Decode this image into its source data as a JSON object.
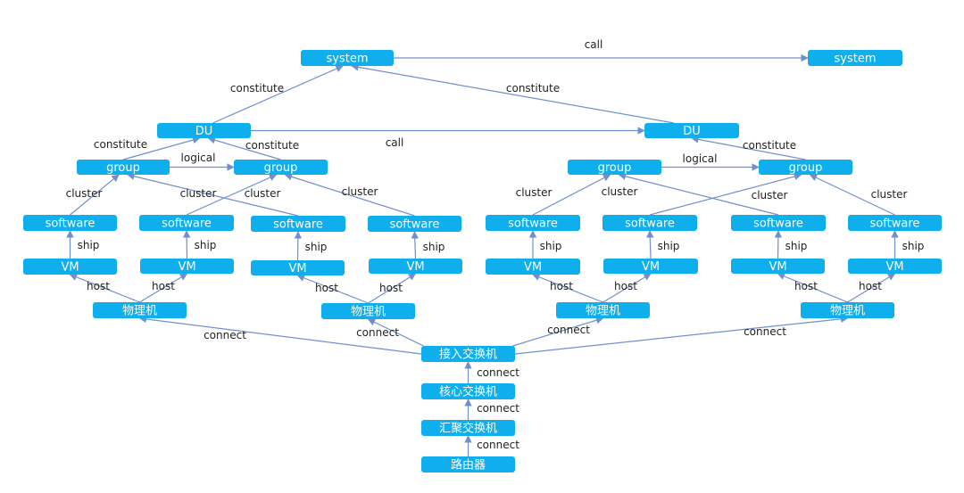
{
  "diagram": {
    "colors": {
      "node_fill": "#0faeec",
      "node_text": "#ffffff",
      "edge": "#6f8fcf",
      "label_text": "#222222"
    },
    "nodes": [
      {
        "id": "system1",
        "label": "system"
      },
      {
        "id": "system2",
        "label": "system"
      },
      {
        "id": "du1",
        "label": "DU"
      },
      {
        "id": "du2",
        "label": "DU"
      },
      {
        "id": "group1",
        "label": "group"
      },
      {
        "id": "group2",
        "label": "group"
      },
      {
        "id": "group3",
        "label": "group"
      },
      {
        "id": "group4",
        "label": "group"
      },
      {
        "id": "sw1",
        "label": "software"
      },
      {
        "id": "sw2",
        "label": "software"
      },
      {
        "id": "sw3",
        "label": "software"
      },
      {
        "id": "sw4",
        "label": "software"
      },
      {
        "id": "sw5",
        "label": "software"
      },
      {
        "id": "sw6",
        "label": "software"
      },
      {
        "id": "sw7",
        "label": "software"
      },
      {
        "id": "sw8",
        "label": "software"
      },
      {
        "id": "vm1",
        "label": "VM"
      },
      {
        "id": "vm2",
        "label": "VM"
      },
      {
        "id": "vm3",
        "label": "VM"
      },
      {
        "id": "vm4",
        "label": "VM"
      },
      {
        "id": "vm5",
        "label": "VM"
      },
      {
        "id": "vm6",
        "label": "VM"
      },
      {
        "id": "vm7",
        "label": "VM"
      },
      {
        "id": "vm8",
        "label": "VM"
      },
      {
        "id": "pm1",
        "label": "物理机"
      },
      {
        "id": "pm2",
        "label": "物理机"
      },
      {
        "id": "pm3",
        "label": "物理机"
      },
      {
        "id": "pm4",
        "label": "物理机"
      },
      {
        "id": "access",
        "label": "接入交换机"
      },
      {
        "id": "core",
        "label": "核心交换机"
      },
      {
        "id": "agg",
        "label": "汇聚交换机"
      },
      {
        "id": "router",
        "label": "路由器"
      }
    ],
    "edges": [
      {
        "from": "system1",
        "to": "system2",
        "label": "call"
      },
      {
        "from": "du1",
        "to": "system1",
        "label": "constitute"
      },
      {
        "from": "du2",
        "to": "system1",
        "label": "constitute"
      },
      {
        "from": "du1",
        "to": "du2",
        "label": "call"
      },
      {
        "from": "group1",
        "to": "du1",
        "label": "constitute"
      },
      {
        "from": "group2",
        "to": "du1",
        "label": "constitute"
      },
      {
        "from": "group1",
        "to": "group2",
        "label": "logical"
      },
      {
        "from": "group4",
        "to": "du2",
        "label": "constitute"
      },
      {
        "from": "group3",
        "to": "group4",
        "label": "logical"
      },
      {
        "from": "sw1",
        "to": "group1",
        "label": "cluster"
      },
      {
        "from": "sw3",
        "to": "group1",
        "label": "cluster"
      },
      {
        "from": "sw2",
        "to": "group2",
        "label": "cluster"
      },
      {
        "from": "sw4",
        "to": "group2",
        "label": "cluster"
      },
      {
        "from": "sw5",
        "to": "group3",
        "label": "cluster"
      },
      {
        "from": "sw7",
        "to": "group3",
        "label": "cluster"
      },
      {
        "from": "sw6",
        "to": "group4",
        "label": "cluster"
      },
      {
        "from": "sw8",
        "to": "group4",
        "label": "cluster"
      },
      {
        "from": "vm1",
        "to": "sw1",
        "label": "ship"
      },
      {
        "from": "vm2",
        "to": "sw2",
        "label": "ship"
      },
      {
        "from": "vm3",
        "to": "sw3",
        "label": "ship"
      },
      {
        "from": "vm4",
        "to": "sw4",
        "label": "ship"
      },
      {
        "from": "vm5",
        "to": "sw5",
        "label": "ship"
      },
      {
        "from": "vm6",
        "to": "sw6",
        "label": "ship"
      },
      {
        "from": "vm7",
        "to": "sw7",
        "label": "ship"
      },
      {
        "from": "vm8",
        "to": "sw8",
        "label": "ship"
      },
      {
        "from": "pm1",
        "to": "vm1",
        "label": "host"
      },
      {
        "from": "pm1",
        "to": "vm2",
        "label": "host"
      },
      {
        "from": "pm2",
        "to": "vm3",
        "label": "host"
      },
      {
        "from": "pm2",
        "to": "vm4",
        "label": "host"
      },
      {
        "from": "pm3",
        "to": "vm5",
        "label": "host"
      },
      {
        "from": "pm3",
        "to": "vm6",
        "label": "host"
      },
      {
        "from": "pm4",
        "to": "vm7",
        "label": "host"
      },
      {
        "from": "pm4",
        "to": "vm8",
        "label": "host"
      },
      {
        "from": "access",
        "to": "pm1",
        "label": "connect"
      },
      {
        "from": "access",
        "to": "pm2",
        "label": "connect"
      },
      {
        "from": "access",
        "to": "pm3",
        "label": "connect"
      },
      {
        "from": "access",
        "to": "pm4",
        "label": "connect"
      },
      {
        "from": "core",
        "to": "access",
        "label": "connect"
      },
      {
        "from": "agg",
        "to": "core",
        "label": "connect"
      },
      {
        "from": "router",
        "to": "agg",
        "label": "connect"
      }
    ]
  }
}
